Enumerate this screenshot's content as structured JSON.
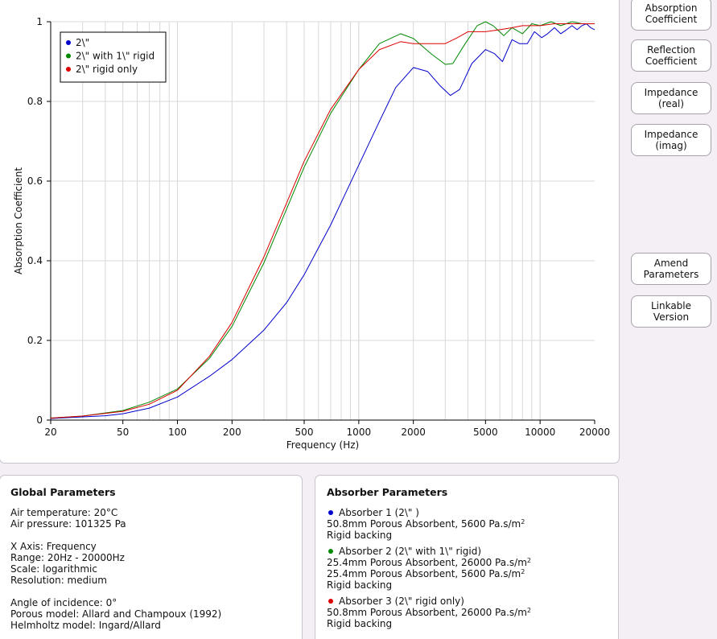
{
  "buttons": {
    "absorption": [
      "Absorption",
      "Coefficient"
    ],
    "reflection": [
      "Reflection",
      "Coefficient"
    ],
    "impedance_real": [
      "Impedance",
      "(real)"
    ],
    "impedance_imag": [
      "Impedance",
      "(imag)"
    ],
    "amend": [
      "Amend",
      "Parameters"
    ],
    "linkable": [
      "Linkable",
      "Version"
    ]
  },
  "global": {
    "title": "Global Parameters",
    "air_temperature": "Air temperature: 20°C",
    "air_pressure": "Air pressure: 101325 Pa",
    "x_axis": "X Axis: Frequency",
    "range": "Range: 20Hz - 20000Hz",
    "scale": "Scale: logarithmic",
    "resolution": "Resolution: medium",
    "angle": "Angle of incidence: 0°",
    "porous_model": "Porous model: Allard and Champoux (1992)",
    "helmholtz_model": "Helmholtz model: Ingard/Allard"
  },
  "absorbers": {
    "title": "Absorber Parameters",
    "items": [
      {
        "label": "Absorber 1 (2\\\" )",
        "color": "#0000cc",
        "layers": [
          "50.8mm Porous Absorbent, 5600 Pa.s/m",
          "Rigid backing"
        ]
      },
      {
        "label": "Absorber 2 (2\\\" with 1\\\" rigid)",
        "color": "#008800",
        "layers": [
          "25.4mm Porous Absorbent, 26000 Pa.s/m",
          "25.4mm Porous Absorbent, 5600 Pa.s/m",
          "Rigid backing"
        ]
      },
      {
        "label": "Absorber 3 (2\\\" rigid only)",
        "color": "#dd0000",
        "layers": [
          "50.8mm Porous Absorbent, 26000 Pa.s/m",
          "Rigid backing"
        ]
      }
    ],
    "unit_exponent": "2"
  },
  "chart_data": {
    "type": "line",
    "xlabel": "Frequency (Hz)",
    "ylabel": "Absorption Coefficient",
    "xscale": "log",
    "xlim": [
      20,
      20000
    ],
    "ylim": [
      0,
      1
    ],
    "xticks": [
      20,
      50,
      100,
      200,
      500,
      1000,
      2000,
      5000,
      10000,
      20000
    ],
    "yticks": [
      0,
      0.2,
      0.4,
      0.6,
      0.8,
      1
    ],
    "ytick_labels": [
      "0",
      "0.2",
      "0.4",
      "0.6",
      "0.8",
      "1"
    ],
    "grid": true,
    "legend_position": "top-left",
    "series": [
      {
        "name": "2\\\"",
        "color": "#0000cc",
        "x": [
          20,
          30,
          40,
          50,
          70,
          100,
          150,
          200,
          300,
          400,
          500,
          700,
          1000,
          1300,
          1600,
          2000,
          2400,
          2800,
          3200,
          3600,
          4200,
          5000,
          5600,
          6200,
          7000,
          7700,
          8500,
          9300,
          10200,
          11000,
          12000,
          13000,
          14000,
          15000,
          16000,
          17000,
          18000,
          19000,
          20000
        ],
        "y": [
          0.004,
          0.008,
          0.011,
          0.016,
          0.03,
          0.058,
          0.11,
          0.152,
          0.226,
          0.295,
          0.365,
          0.49,
          0.64,
          0.75,
          0.835,
          0.885,
          0.875,
          0.84,
          0.815,
          0.83,
          0.895,
          0.93,
          0.92,
          0.9,
          0.955,
          0.945,
          0.945,
          0.975,
          0.96,
          0.97,
          0.985,
          0.97,
          0.98,
          0.99,
          0.98,
          0.99,
          0.995,
          0.985,
          0.98
        ]
      },
      {
        "name": "2\\\" with 1\\\" rigid",
        "color": "#008800",
        "x": [
          20,
          30,
          50,
          70,
          100,
          150,
          200,
          300,
          400,
          500,
          700,
          1000,
          1300,
          1700,
          2000,
          2500,
          3000,
          3300,
          3800,
          4500,
          5000,
          5500,
          6300,
          7000,
          8000,
          9000,
          10000,
          11500,
          13000,
          15000,
          17000,
          20000
        ],
        "y": [
          0.005,
          0.01,
          0.024,
          0.045,
          0.078,
          0.155,
          0.235,
          0.395,
          0.53,
          0.635,
          0.77,
          0.88,
          0.945,
          0.97,
          0.958,
          0.92,
          0.893,
          0.895,
          0.94,
          0.99,
          1.0,
          0.99,
          0.965,
          0.985,
          0.97,
          0.995,
          0.99,
          1.0,
          0.99,
          1.0,
          0.995,
          0.995
        ]
      },
      {
        "name": "2\\\" rigid only",
        "color": "#dd0000",
        "x": [
          20,
          30,
          50,
          70,
          100,
          150,
          200,
          300,
          400,
          500,
          700,
          1000,
          1300,
          1700,
          2000,
          2500,
          3000,
          3500,
          4000,
          5000,
          6000,
          7000,
          8000,
          10000,
          12000,
          15000,
          20000
        ],
        "y": [
          0.005,
          0.01,
          0.022,
          0.04,
          0.075,
          0.16,
          0.245,
          0.41,
          0.545,
          0.65,
          0.78,
          0.88,
          0.93,
          0.95,
          0.945,
          0.945,
          0.945,
          0.96,
          0.975,
          0.975,
          0.98,
          0.985,
          0.99,
          0.99,
          0.995,
          0.995,
          0.995
        ]
      }
    ]
  }
}
